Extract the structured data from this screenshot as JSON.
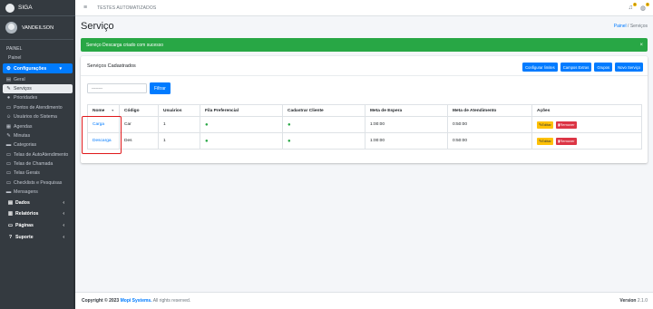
{
  "brand": {
    "name": "SIGA"
  },
  "user": {
    "name": "VANDEILSON"
  },
  "sidebar": {
    "header": "PAINEL",
    "items": [
      {
        "label": "Painel",
        "icon": "none"
      },
      {
        "label": "Configurações",
        "icon": "gear-icon",
        "active": true
      },
      {
        "label": "Geral",
        "icon": "printer-icon"
      },
      {
        "label": "Serviços",
        "icon": "wrench-icon",
        "selected": true
      },
      {
        "label": "Prioridades",
        "icon": "circle-icon"
      },
      {
        "label": "Pontos de Atendimento",
        "icon": "desktop-icon"
      },
      {
        "label": "Usuários do Sistema",
        "icon": "users-icon"
      },
      {
        "label": "Agendas",
        "icon": "calendar-icon"
      },
      {
        "label": "Minutas",
        "icon": "edit-icon"
      },
      {
        "label": "Categorias",
        "icon": "folder-icon"
      },
      {
        "label": "Telas de AutoAtendimento",
        "icon": "desktop-icon"
      },
      {
        "label": "Telas de Chamada",
        "icon": "desktop-icon"
      },
      {
        "label": "Telas Gerais",
        "icon": "desktop-icon"
      },
      {
        "label": "Checklists e Pesquisas",
        "icon": "desktop-icon"
      },
      {
        "label": "Mensagens",
        "icon": "message-icon"
      },
      {
        "label": "Dados",
        "icon": "database-icon"
      },
      {
        "label": "Relatórios",
        "icon": "chart-icon"
      },
      {
        "label": "Páginas",
        "icon": "desktop-icon"
      },
      {
        "label": "Suporte",
        "icon": "question-icon"
      }
    ]
  },
  "topbar": {
    "title": "TESTES AUTOMATIZADOS",
    "badge1": "0",
    "badge2": "0"
  },
  "page": {
    "title": "Serviço",
    "breadcrumb_home": "Painel",
    "breadcrumb_sep": "/",
    "breadcrumb_current": "Serviços"
  },
  "alert": {
    "message": "Serviço Descarga criado com sucesso",
    "close": "×"
  },
  "card": {
    "title": "Serviços Cadastrados",
    "buttons": [
      "Configurar limites",
      "Campos Extras",
      "Grupos",
      "Novo Serviço"
    ],
    "filter_placeholder": "--------",
    "filter_button": "Filtrar"
  },
  "table": {
    "headers": [
      "Nome",
      "Código",
      "Usuários",
      "Fila Preferencial",
      "Cadastrar Cliente",
      "Meta de Espera",
      "Meta de Atendimento",
      "Ações"
    ],
    "rows": [
      {
        "nome": "Carga",
        "codigo": "Car",
        "usuarios": "1",
        "meta_espera": "1:00:00",
        "meta_atendimento": "0:50:00",
        "edit": "Editar",
        "remove": "Remover"
      },
      {
        "nome": "Descarga",
        "codigo": "Des",
        "usuarios": "1",
        "meta_espera": "1:00:00",
        "meta_atendimento": "0:50:00",
        "edit": "Editar",
        "remove": "Remover"
      }
    ]
  },
  "footer": {
    "prefix": "Copyright © 2023",
    "company": "Mopi Systems.",
    "rights": "All rights reserved.",
    "version_label": "Version",
    "version": "2.1.0"
  }
}
